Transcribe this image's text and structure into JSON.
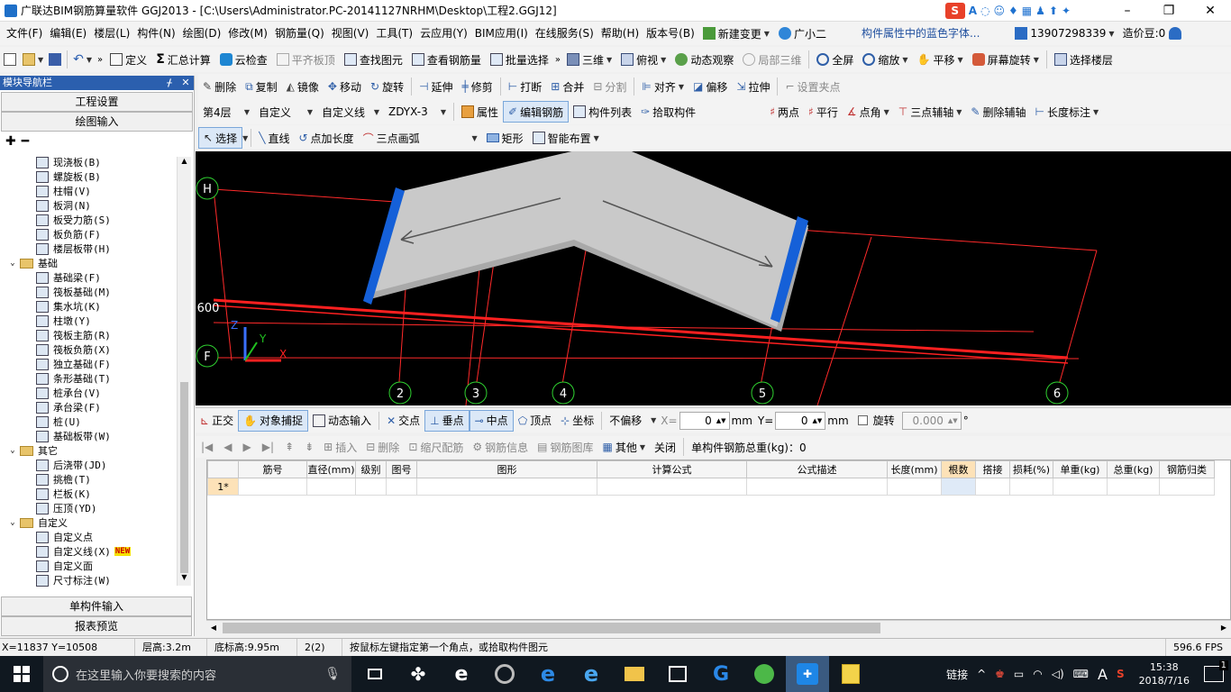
{
  "window": {
    "title": "广联达BIM钢筋算量软件 GGJ2013 - [C:\\Users\\Administrator.PC-20141127NRHM\\Desktop\\工程2.GGJ12]",
    "controls": [
      "–",
      "❐",
      "✕"
    ]
  },
  "menubar": {
    "items": [
      "文件(F)",
      "编辑(E)",
      "楼层(L)",
      "构件(N)",
      "绘图(D)",
      "修改(M)",
      "钢筋量(Q)",
      "视图(V)",
      "工具(T)",
      "云应用(Y)",
      "BIM应用(I)",
      "在线服务(S)",
      "帮助(H)",
      "版本号(B)"
    ],
    "new_change": "新建变更",
    "assistant": "广小二",
    "hint": "构件属性中的蓝色字体...",
    "phone": "13907298339",
    "beans": "造价豆:0"
  },
  "toolbar1": {
    "items": [
      "定义",
      "汇总计算",
      "云检查",
      "平齐板顶",
      "查找图元",
      "查看钢筋量",
      "批量选择",
      "三维",
      "俯视",
      "动态观察",
      "局部三维",
      "全屏",
      "缩放",
      "平移",
      "屏幕旋转",
      "选择楼层"
    ]
  },
  "toolbar2": {
    "items": [
      "删除",
      "复制",
      "镜像",
      "移动",
      "旋转",
      "延伸",
      "修剪",
      "打断",
      "合并",
      "分割",
      "对齐",
      "偏移",
      "拉伸",
      "设置夹点"
    ]
  },
  "toolbar3": {
    "floor": "第4层",
    "type": "自定义",
    "subtype": "自定义线",
    "component": "ZDYX-3",
    "items": [
      "属性",
      "编辑钢筋",
      "构件列表",
      "拾取构件",
      "两点",
      "平行",
      "点角",
      "三点辅轴",
      "删除辅轴",
      "长度标注"
    ]
  },
  "toolbar4": {
    "items": [
      "选择",
      "直线",
      "点加长度",
      "三点画弧",
      "矩形",
      "智能布置"
    ]
  },
  "navpanel": {
    "title": "模块导航栏",
    "pin": "ᚋ",
    "close": "✕",
    "top_buttons": [
      "工程设置",
      "绘图输入"
    ],
    "bottom_buttons": [
      "单构件输入",
      "报表预览"
    ],
    "tree": [
      {
        "label": "现浇板(B)",
        "indent": 2,
        "kind": "item"
      },
      {
        "label": "螺旋板(B)",
        "indent": 2,
        "kind": "item"
      },
      {
        "label": "柱帽(V)",
        "indent": 2,
        "kind": "item"
      },
      {
        "label": "板洞(N)",
        "indent": 2,
        "kind": "item"
      },
      {
        "label": "板受力筋(S)",
        "indent": 2,
        "kind": "item"
      },
      {
        "label": "板负筋(F)",
        "indent": 2,
        "kind": "item"
      },
      {
        "label": "楼层板带(H)",
        "indent": 2,
        "kind": "item"
      },
      {
        "label": "基础",
        "indent": 1,
        "kind": "folder"
      },
      {
        "label": "基础梁(F)",
        "indent": 2,
        "kind": "item"
      },
      {
        "label": "筏板基础(M)",
        "indent": 2,
        "kind": "item"
      },
      {
        "label": "集水坑(K)",
        "indent": 2,
        "kind": "item"
      },
      {
        "label": "柱墩(Y)",
        "indent": 2,
        "kind": "item"
      },
      {
        "label": "筏板主筋(R)",
        "indent": 2,
        "kind": "item"
      },
      {
        "label": "筏板负筋(X)",
        "indent": 2,
        "kind": "item"
      },
      {
        "label": "独立基础(F)",
        "indent": 2,
        "kind": "item"
      },
      {
        "label": "条形基础(T)",
        "indent": 2,
        "kind": "item"
      },
      {
        "label": "桩承台(V)",
        "indent": 2,
        "kind": "item"
      },
      {
        "label": "承台梁(F)",
        "indent": 2,
        "kind": "item"
      },
      {
        "label": "桩(U)",
        "indent": 2,
        "kind": "item"
      },
      {
        "label": "基础板带(W)",
        "indent": 2,
        "kind": "item"
      },
      {
        "label": "其它",
        "indent": 1,
        "kind": "folder"
      },
      {
        "label": "后浇带(JD)",
        "indent": 2,
        "kind": "item"
      },
      {
        "label": "挑檐(T)",
        "indent": 2,
        "kind": "item"
      },
      {
        "label": "栏板(K)",
        "indent": 2,
        "kind": "item"
      },
      {
        "label": "压顶(YD)",
        "indent": 2,
        "kind": "item"
      },
      {
        "label": "自定义",
        "indent": 1,
        "kind": "folder"
      },
      {
        "label": "自定义点",
        "indent": 2,
        "kind": "item"
      },
      {
        "label": "自定义线(X)",
        "indent": 2,
        "kind": "item",
        "badge": "NEW"
      },
      {
        "label": "自定义面",
        "indent": 2,
        "kind": "item"
      },
      {
        "label": "尺寸标注(W)",
        "indent": 2,
        "kind": "item"
      }
    ]
  },
  "canvas": {
    "axis_labels": [
      "H",
      "F",
      "2",
      "3",
      "4",
      "5",
      "6"
    ],
    "dimension": "600",
    "ucs": {
      "z": "Z",
      "y": "Y",
      "x": "X"
    }
  },
  "snapbar": {
    "items": [
      "正交",
      "对象捕捉",
      "动态输入",
      "交点",
      "垂点",
      "中点",
      "顶点",
      "坐标"
    ],
    "offset_mode": "不偏移",
    "x_label": "X=",
    "x_value": "0",
    "unit": "mm",
    "y_label": "Y=",
    "y_value": "0",
    "rotate_label": "旋转",
    "rotate_value": "0.000",
    "degree": "°"
  },
  "gridtoolbar": {
    "items": [
      "插入",
      "删除",
      "缩尺配筋",
      "钢筋信息",
      "钢筋图库",
      "其他",
      "关闭"
    ],
    "total": "单构件钢筋总重(kg)：0"
  },
  "rebar_table": {
    "columns": [
      "筋号",
      "直径(mm)",
      "级别",
      "图号",
      "图形",
      "计算公式",
      "公式描述",
      "长度(mm)",
      "根数",
      "搭接",
      "损耗(%)",
      "单重(kg)",
      "总重(kg)",
      "钢筋归类"
    ],
    "rows": [
      [
        "1*",
        "",
        "",
        "",
        "",
        "",
        "",
        "",
        "",
        "",
        "",
        "",
        "",
        "",
        ""
      ]
    ]
  },
  "statusbar": {
    "coords": "X=11837 Y=10508",
    "floor_height": "层高:3.2m",
    "bottom_elev": "底标高:9.95m",
    "count": "2(2)",
    "hint": "按鼠标左键指定第一个角点，或拾取构件图元",
    "fps": "596.6 FPS"
  },
  "taskbar": {
    "search_placeholder": "在这里输入你要搜索的内容",
    "link": "链接",
    "ime": "A",
    "time": "15:38",
    "date": "2018/7/16",
    "notifications": "1"
  },
  "colors": {
    "accent": "#1e6fc8",
    "nav_header": "#2b5fae",
    "grid_red": "#ff2020",
    "slab": "#c9c9c9",
    "rebar_blue": "#1560d8"
  }
}
